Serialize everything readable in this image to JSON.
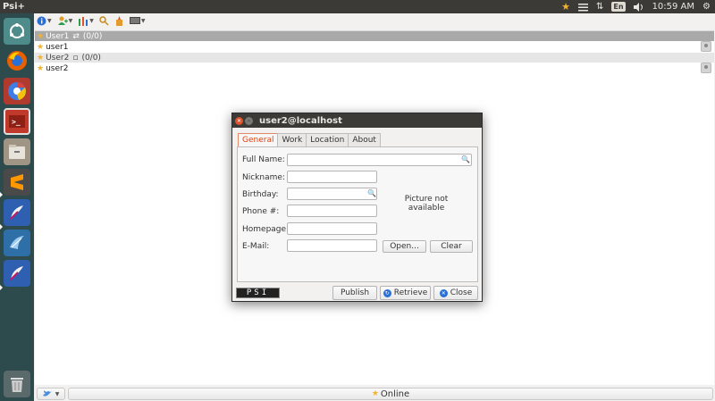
{
  "panel": {
    "app_title": "Psi+",
    "keyboard": "En",
    "clock": "10:59 AM",
    "star_icon": "star-icon",
    "tray_icons": [
      "star-icon",
      "menu-icon",
      "network-arrows-icon",
      "keyboard-layout-icon",
      "volume-icon",
      "settings-gear-icon"
    ]
  },
  "launcher": {
    "items": [
      "ubuntu-dash-icon",
      "firefox-icon",
      "chrome-beta-icon",
      "terminal-red-icon",
      "files-icon",
      "sublime-text-icon",
      "psi-feather-icon",
      "wireshark-icon",
      "psi-plus-feather-icon",
      "trash-icon"
    ]
  },
  "toolbar": {
    "items": [
      "info-menu-icon",
      "add-contact-menu-icon",
      "options-menu-icon",
      "search-user-icon",
      "bookmarks-icon",
      "display-menu-icon"
    ]
  },
  "roster": {
    "groups": [
      {
        "name": "User1",
        "count": "(0/0)",
        "contacts": [
          "user1"
        ]
      },
      {
        "name": "User2",
        "count": "(0/0)",
        "contacts": [
          "user2"
        ]
      }
    ]
  },
  "statusbar": {
    "status": "Online"
  },
  "dialog": {
    "title": "user2@localhost",
    "tabs": [
      "General",
      "Work",
      "Location",
      "About"
    ],
    "active_tab": "General",
    "fields": {
      "full_name": {
        "label": "Full Name:",
        "value": ""
      },
      "nickname": {
        "label": "Nickname:",
        "value": ""
      },
      "birthday": {
        "label": "Birthday:",
        "value": ""
      },
      "phone": {
        "label": "Phone #:",
        "value": ""
      },
      "homepage": {
        "label": "Homepage:",
        "value": ""
      },
      "email": {
        "label": "E-Mail:",
        "value": ""
      }
    },
    "picture_text": "Picture not available",
    "open_label": "Open...",
    "clear_label": "Clear",
    "logo_text": "PSI",
    "publish_label": "Publish",
    "retrieve_label": "Retrieve",
    "close_label": "Close"
  },
  "colors": {
    "panel_bg": "#3b3a36",
    "launcher_bg": "#2d4b4c",
    "accent_orange": "#e0522a",
    "star_yellow": "#f2b22f"
  }
}
